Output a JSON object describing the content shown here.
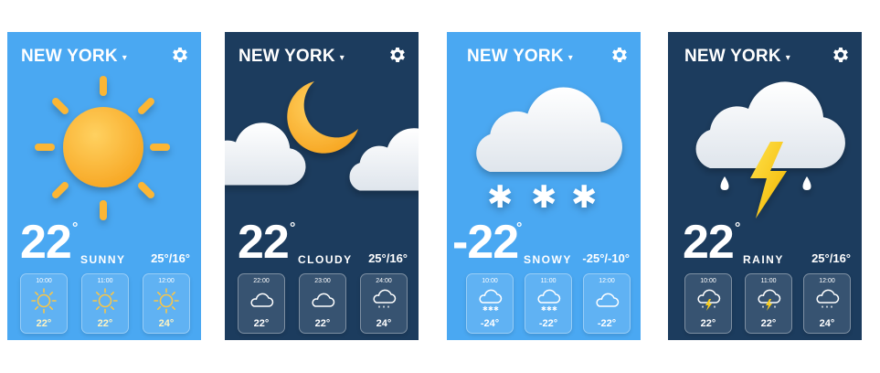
{
  "colors": {
    "light_bg": "#4aa8f2",
    "dark_bg": "#1c3c5e",
    "sun": "#fbb634",
    "bolt": "#f6cc1e",
    "cloud": "#f2f5f8"
  },
  "cards": [
    {
      "city": "NEW YORK",
      "caret": "▾",
      "temperature": "22",
      "degree": "°",
      "condition": "SUNNY",
      "range": "25°/16°",
      "main_icon": "sun-icon",
      "hours": [
        {
          "time": "10:00",
          "temp": "22°",
          "icon": "sun-icon"
        },
        {
          "time": "11:00",
          "temp": "22°",
          "icon": "sun-icon"
        },
        {
          "time": "12:00",
          "temp": "24°",
          "icon": "sun-icon"
        }
      ]
    },
    {
      "city": "NEW YORK",
      "caret": "▾",
      "temperature": "22",
      "degree": "°",
      "condition": "CLOUDY",
      "range": "25°/16°",
      "main_icon": "moon-clouds-icon",
      "hours": [
        {
          "time": "22:00",
          "temp": "22°",
          "icon": "cloud-icon"
        },
        {
          "time": "23:00",
          "temp": "22°",
          "icon": "cloud-icon"
        },
        {
          "time": "24:00",
          "temp": "24°",
          "icon": "rain-cloud-icon"
        }
      ]
    },
    {
      "city": "NEW YORK",
      "caret": "▾",
      "temperature": "-22",
      "degree": "°",
      "condition": "SNOWY",
      "range": "-25°/-10°",
      "main_icon": "snow-cloud-icon",
      "hours": [
        {
          "time": "10:00",
          "temp": "-24°",
          "icon": "snow-cloud-icon"
        },
        {
          "time": "11:00",
          "temp": "-22°",
          "icon": "snow-cloud-icon"
        },
        {
          "time": "12:00",
          "temp": "-22°",
          "icon": "cloud-icon"
        }
      ]
    },
    {
      "city": "NEW YORK",
      "caret": "▾",
      "temperature": "22",
      "degree": "°",
      "condition": "RAINY",
      "range": "25°/16°",
      "main_icon": "storm-cloud-icon",
      "hours": [
        {
          "time": "10:00",
          "temp": "22°",
          "icon": "storm-cloud-icon"
        },
        {
          "time": "11:00",
          "temp": "22°",
          "icon": "storm-cloud-icon"
        },
        {
          "time": "12:00",
          "temp": "24°",
          "icon": "rain-cloud-icon"
        }
      ]
    }
  ]
}
